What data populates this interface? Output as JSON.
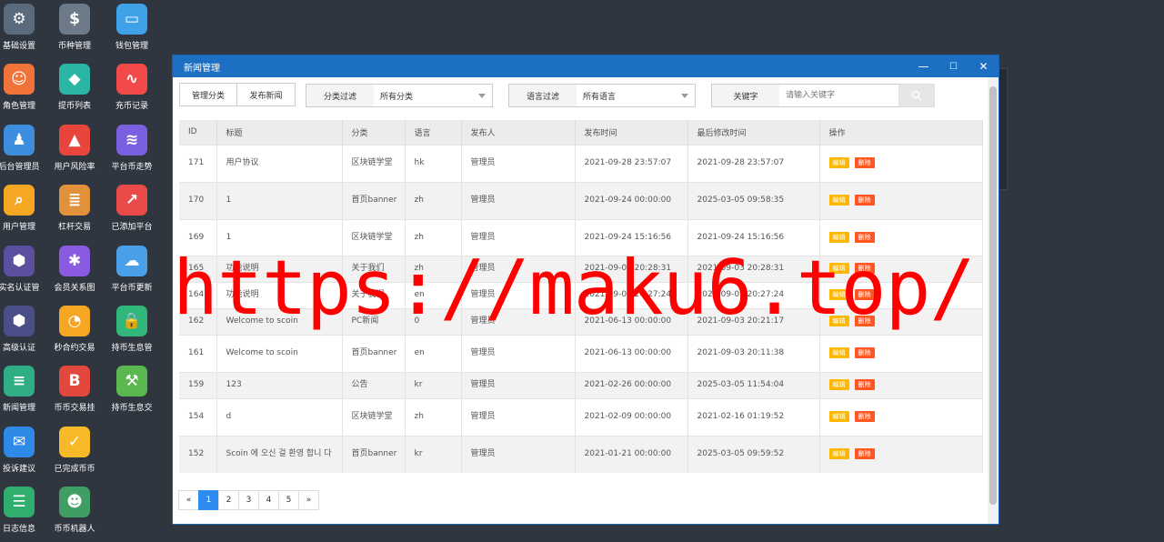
{
  "desktop_icons": [
    {
      "label": "基础设置",
      "icon": "gear-icon",
      "color": "#5a6b7d",
      "glyph": "⚙"
    },
    {
      "label": "币种管理",
      "icon": "dollar-coin-icon",
      "color": "#6c7a89",
      "glyph": "$"
    },
    {
      "label": "钱包管理",
      "icon": "wallet-icon",
      "color": "#3fa1e8",
      "glyph": "▭"
    },
    {
      "label": "角色管理",
      "icon": "roles-icon",
      "color": "#f0743a",
      "glyph": "☺"
    },
    {
      "label": "提币列表",
      "icon": "withdraw-icon",
      "color": "#2ab5a5",
      "glyph": "◆"
    },
    {
      "label": "充币记录",
      "icon": "deposit-record-icon",
      "color": "#f24a4a",
      "glyph": "∿"
    },
    {
      "label": "后台管理员",
      "icon": "admin-user-icon",
      "color": "#3e8ee0",
      "glyph": "♟"
    },
    {
      "label": "用户风险率",
      "icon": "risk-alarm-icon",
      "color": "#e8463c",
      "glyph": "▲"
    },
    {
      "label": "平台币走势",
      "icon": "layers-icon",
      "color": "#7a5fe0",
      "glyph": "≋"
    },
    {
      "label": "用户管理",
      "icon": "user-search-icon",
      "color": "#f5a623",
      "glyph": "⌕"
    },
    {
      "label": "杠杆交易",
      "icon": "stack-icon",
      "color": "#e0913a",
      "glyph": "≣"
    },
    {
      "label": "已添加平台",
      "icon": "trend-icon",
      "color": "#e94b4b",
      "glyph": "↗"
    },
    {
      "label": "实名认证管",
      "icon": "id-verify-icon",
      "color": "#5b4fa0",
      "glyph": "⬢"
    },
    {
      "label": "会员关系图",
      "icon": "relation-icon",
      "color": "#8a5be0",
      "glyph": "✱"
    },
    {
      "label": "平台币更新",
      "icon": "cloud-sync-icon",
      "color": "#4aa0e8",
      "glyph": "☁"
    },
    {
      "label": "高级认证",
      "icon": "advanced-verify-icon",
      "color": "#4a4f8a",
      "glyph": "⬢"
    },
    {
      "label": "秒合约交易",
      "icon": "stopwatch-icon",
      "color": "#f5a623",
      "glyph": "◔"
    },
    {
      "label": "持币生息管",
      "icon": "lock-icon",
      "color": "#2fb87a",
      "glyph": "🔒"
    },
    {
      "label": "新闻管理",
      "icon": "news-doc-icon",
      "color": "#2fae85",
      "glyph": "≡"
    },
    {
      "label": "币币交易挂",
      "icon": "bitcoin-icon",
      "color": "#e2483d",
      "glyph": "B"
    },
    {
      "label": "持币生息交",
      "icon": "hammer-icon",
      "color": "#5bb84f",
      "glyph": "⚒"
    },
    {
      "label": "投诉建议",
      "icon": "feedback-icon",
      "color": "#2e8ae6",
      "glyph": "✉"
    },
    {
      "label": "已完成币币",
      "icon": "check-box-icon",
      "color": "#f7b928",
      "glyph": "✓"
    },
    {
      "label": "",
      "icon": "",
      "color": "",
      "glyph": ""
    },
    {
      "label": "日志信息",
      "icon": "log-icon",
      "color": "#2fae6e",
      "glyph": "☰"
    },
    {
      "label": "币币机器人",
      "icon": "robot-icon",
      "color": "#3e9e63",
      "glyph": "☻"
    }
  ],
  "window": {
    "title": "新闻管理",
    "minimize": "—",
    "maximize": "☐",
    "close": "✕"
  },
  "toolbar": {
    "manage_category": "管理分类",
    "publish_news": "发布新闻",
    "category_filter_label": "分类过滤",
    "category_filter_value": "所有分类",
    "language_filter_label": "语言过滤",
    "language_filter_value": "所有语言",
    "keyword_label": "关键字",
    "keyword_placeholder": "请输入关键字"
  },
  "table": {
    "headers": [
      "ID",
      "标题",
      "分类",
      "语言",
      "发布人",
      "发布时间",
      "最后修改时间",
      "操作"
    ],
    "edit_label": "编辑",
    "delete_label": "删除",
    "rows": [
      {
        "id": "171",
        "title": "用户协议",
        "category": "区块链学堂",
        "lang": "hk",
        "publisher": "管理员",
        "published": "2021-09-28 23:57:07",
        "modified": "2021-09-28 23:57:07"
      },
      {
        "id": "170",
        "title": "1",
        "category": "首页banner",
        "lang": "zh",
        "publisher": "管理员",
        "published": "2021-09-24 00:00:00",
        "modified": "2025-03-05 09:58:35"
      },
      {
        "id": "169",
        "title": "1",
        "category": "区块链学堂",
        "lang": "zh",
        "publisher": "管理员",
        "published": "2021-09-24 15:16:56",
        "modified": "2021-09-24 15:16:56"
      },
      {
        "id": "165",
        "title": "功能说明",
        "category": "关于我们",
        "lang": "zh",
        "publisher": "管理员",
        "published": "2021-09-03 20:28:31",
        "modified": "2021-09-03 20:28:31"
      },
      {
        "id": "164",
        "title": "功能说明",
        "category": "关于我们",
        "lang": "en",
        "publisher": "管理员",
        "published": "2021-09-03 20:27:24",
        "modified": "2021-09-03 20:27:24"
      },
      {
        "id": "162",
        "title": "Welcome to scoin",
        "category": "PC新闻",
        "lang": "0",
        "publisher": "管理员",
        "published": "2021-06-13 00:00:00",
        "modified": "2021-09-03 20:21:17"
      },
      {
        "id": "161",
        "title": "Welcome to scoin",
        "category": "首页banner",
        "lang": "en",
        "publisher": "管理员",
        "published": "2021-06-13 00:00:00",
        "modified": "2021-09-03 20:11:38"
      },
      {
        "id": "159",
        "title": "123",
        "category": "公告",
        "lang": "kr",
        "publisher": "管理员",
        "published": "2021-02-26 00:00:00",
        "modified": "2025-03-05 11:54:04"
      },
      {
        "id": "154",
        "title": "d",
        "category": "区块链学堂",
        "lang": "zh",
        "publisher": "管理员",
        "published": "2021-02-09 00:00:00",
        "modified": "2021-02-16 01:19:52"
      },
      {
        "id": "152",
        "title": "Scoin 에 오신 걸 환영 합니 다",
        "category": "首页banner",
        "lang": "kr",
        "publisher": "管理员",
        "published": "2021-01-21 00:00:00",
        "modified": "2025-03-05 09:59:52"
      }
    ]
  },
  "pagination": {
    "prev": "«",
    "pages": [
      "1",
      "2",
      "3",
      "4",
      "5"
    ],
    "next": "»",
    "current": "1"
  },
  "watermark": "https://maku6.top/",
  "colors": {
    "titlebar": "#1c6fc2",
    "edit_badge": "#ffb800",
    "delete_badge": "#ff5722",
    "active_page": "#2d8cf0",
    "desktop_bg": "#2f3640"
  }
}
